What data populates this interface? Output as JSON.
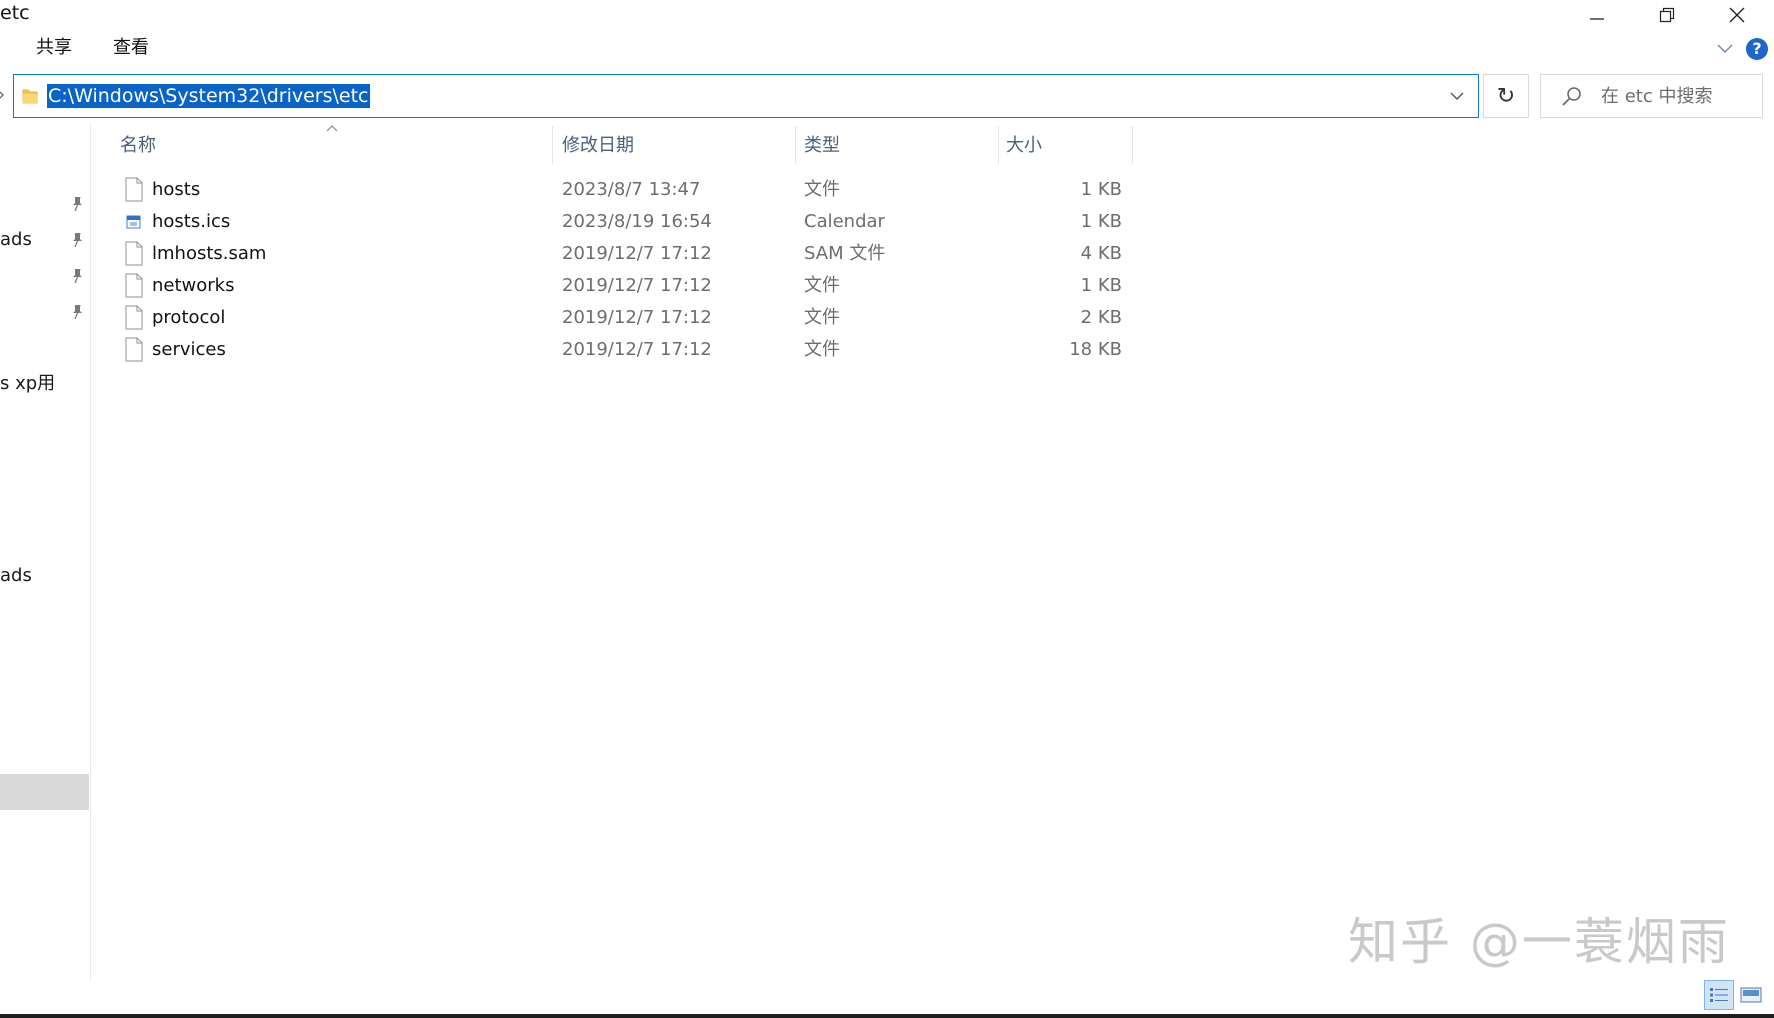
{
  "window": {
    "title": "etc"
  },
  "ribbon": {
    "tabs": [
      "共享",
      "查看"
    ],
    "help_label": "?"
  },
  "address_bar": {
    "path": "C:\\Windows\\System32\\drivers\\etc",
    "refresh_glyph": "↻"
  },
  "search": {
    "placeholder": "在 etc 中搜索"
  },
  "nav_pane": {
    "items": [
      "ads",
      "s xp用",
      "ads"
    ]
  },
  "columns": {
    "name": "名称",
    "date": "修改日期",
    "type": "类型",
    "size": "大小"
  },
  "files": [
    {
      "name": "hosts",
      "date": "2023/8/7 13:47",
      "type": "文件",
      "size": "1 KB",
      "icon": "blank-file-icon"
    },
    {
      "name": "hosts.ics",
      "date": "2023/8/19 16:54",
      "type": "Calendar",
      "size": "1 KB",
      "icon": "calendar-file-icon"
    },
    {
      "name": "lmhosts.sam",
      "date": "2019/12/7 17:12",
      "type": "SAM 文件",
      "size": "4 KB",
      "icon": "blank-file-icon"
    },
    {
      "name": "networks",
      "date": "2019/12/7 17:12",
      "type": "文件",
      "size": "1 KB",
      "icon": "blank-file-icon"
    },
    {
      "name": "protocol",
      "date": "2019/12/7 17:12",
      "type": "文件",
      "size": "2 KB",
      "icon": "blank-file-icon"
    },
    {
      "name": "services",
      "date": "2019/12/7 17:12",
      "type": "文件",
      "size": "18 KB",
      "icon": "blank-file-icon"
    }
  ],
  "watermark": {
    "text": "知乎 @一蓑烟雨"
  },
  "colors": {
    "selection": "#0a63c9",
    "address_border": "#0b79d0",
    "help_blue": "#1c67c9",
    "header_text": "#4c607a"
  }
}
